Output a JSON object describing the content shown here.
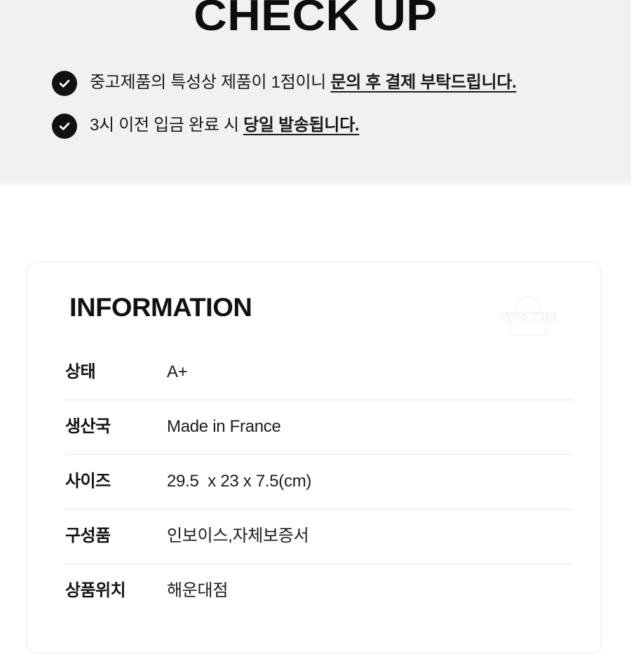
{
  "checkup": {
    "title": "CHECK UP",
    "items": [
      {
        "icon": "check-circle-icon",
        "text_plain": "중고제품의 특성상 제품이 1점이니 ",
        "text_emphasis": "문의 후 결제 부탁드립니다."
      },
      {
        "icon": "check-circle-icon",
        "text_plain": "3시 이전 입금 완료 시 ",
        "text_emphasis": "당일 발송됩니다."
      }
    ]
  },
  "information": {
    "title": "INFORMATION",
    "watermark": {
      "label": "착한중고명품",
      "icon": "handbag-outline-icon"
    },
    "rows": [
      {
        "label": "상태",
        "value": "A+"
      },
      {
        "label": "생산국",
        "value": "Made in France"
      },
      {
        "label": "사이즈",
        "value": "29.5  x 23 x 7.5(cm)"
      },
      {
        "label": "구성품",
        "value": "인보이스,자체보증서"
      },
      {
        "label": "상품위치",
        "value": "해운대점"
      }
    ]
  },
  "colors": {
    "band_background": "#f1f1f1",
    "page_background": "#ffffff",
    "text_primary": "#111111",
    "icon_fill": "#111111",
    "divider": "#e6e6e6",
    "card_border": "#ededed",
    "watermark": "#f0f0f0"
  }
}
